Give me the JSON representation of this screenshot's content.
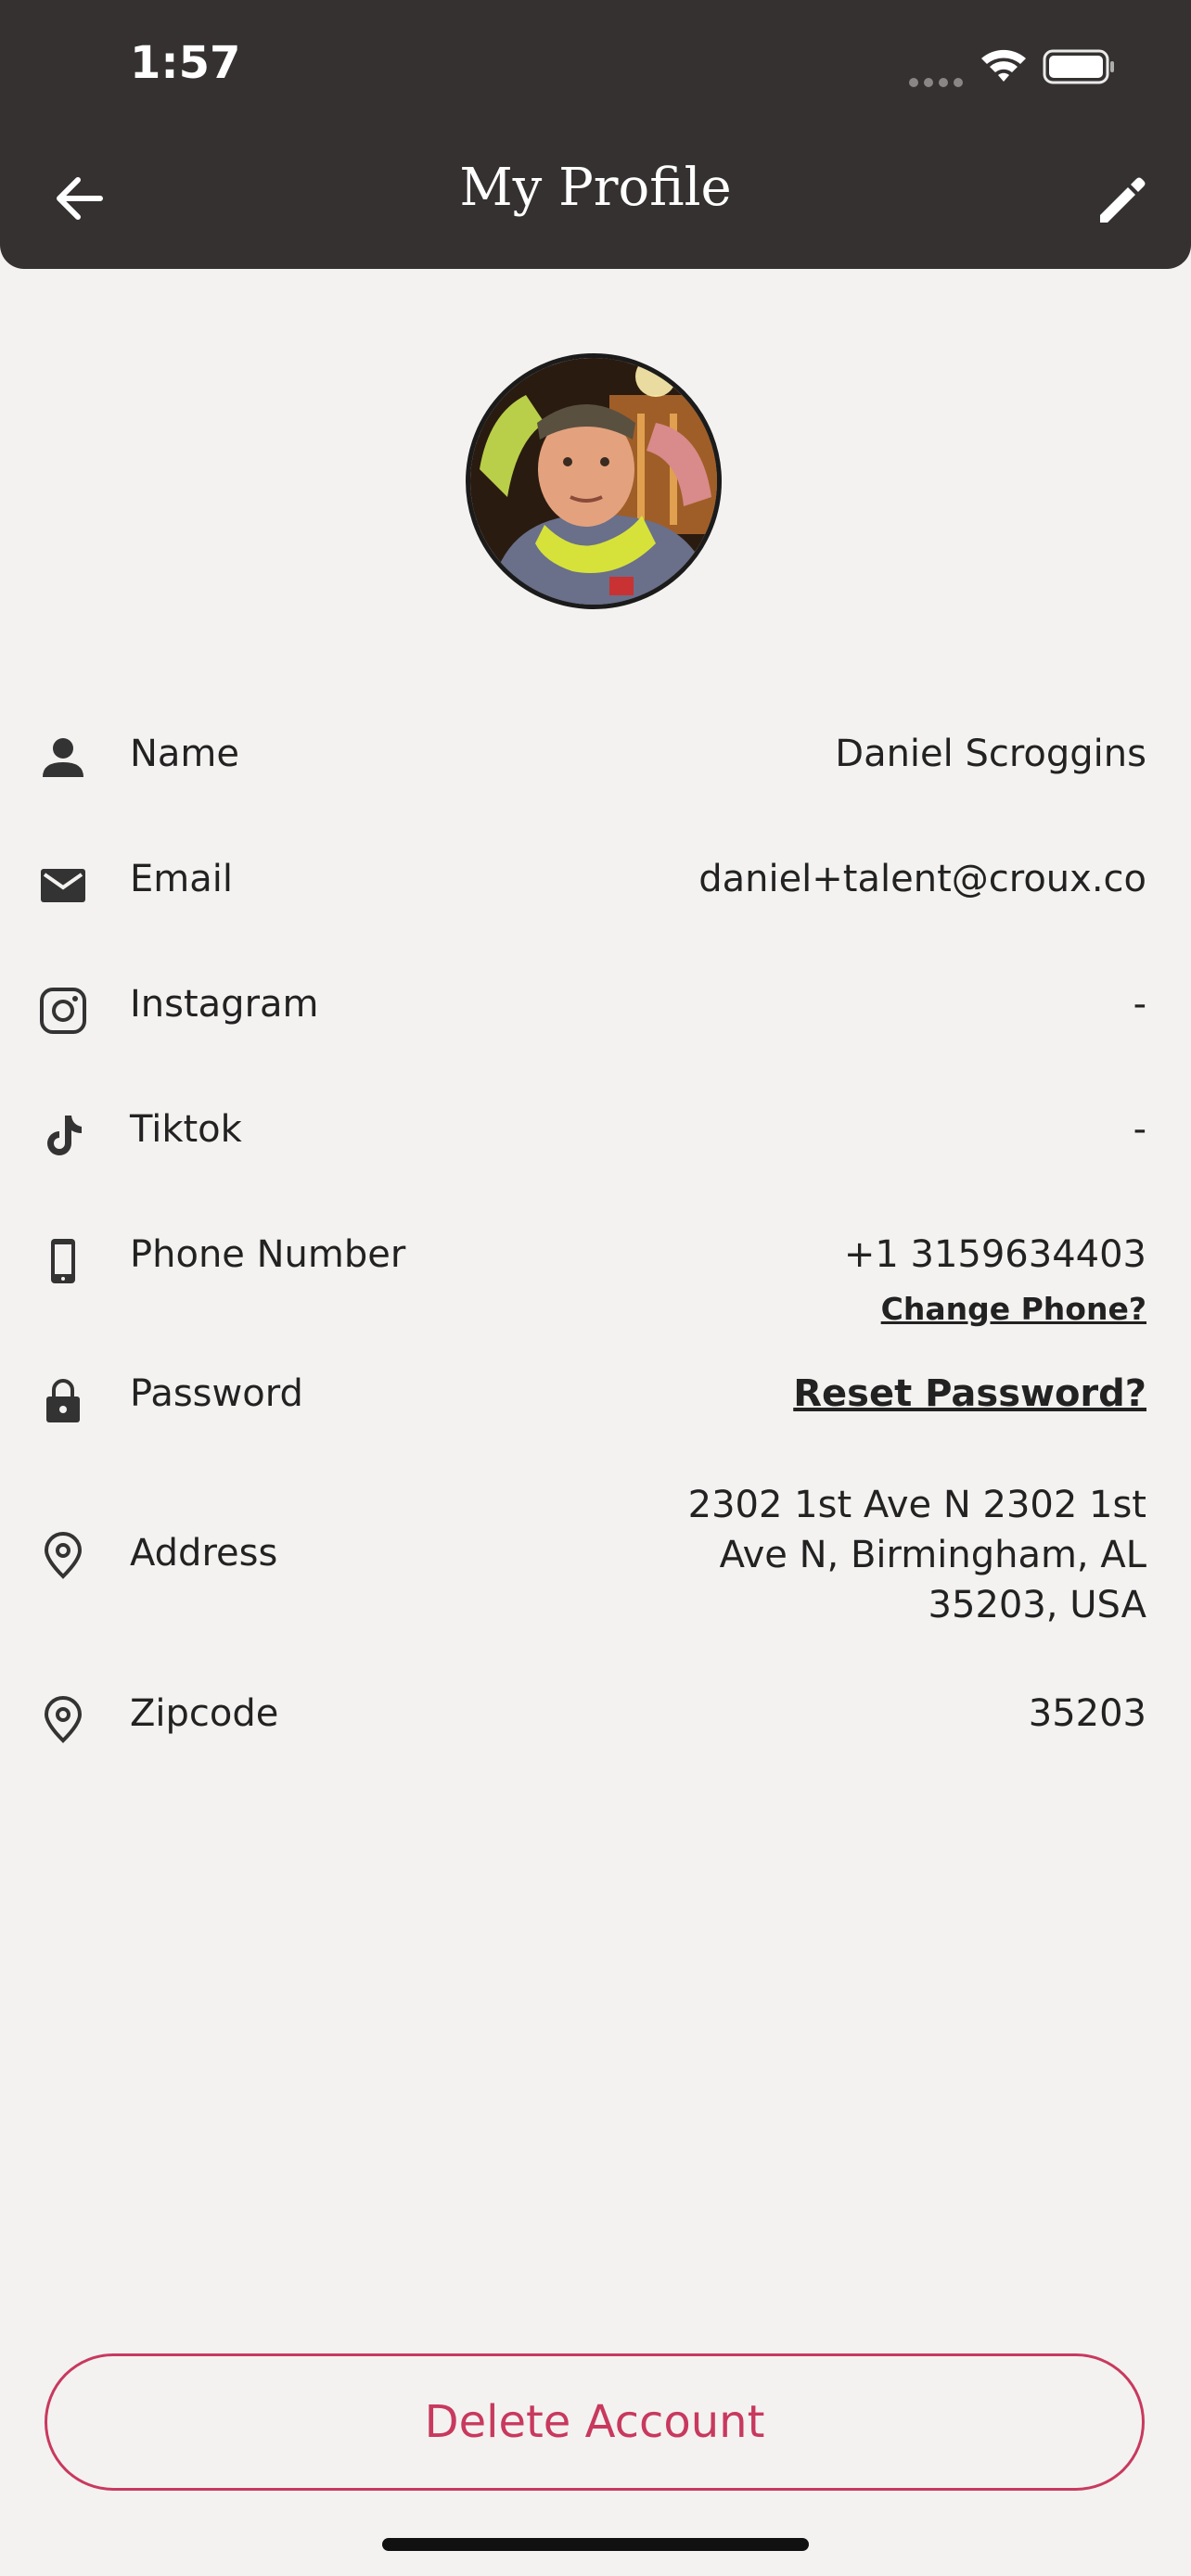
{
  "status_bar": {
    "time": "1:57"
  },
  "header": {
    "title": "My Profile"
  },
  "profile": {
    "name_label": "Name",
    "name_value": "Daniel Scroggins",
    "email_label": "Email",
    "email_value": "daniel+talent@croux.co",
    "instagram_label": "Instagram",
    "instagram_value": "-",
    "tiktok_label": "Tiktok",
    "tiktok_value": "-",
    "phone_label": "Phone Number",
    "phone_value": "+1 3159634403",
    "phone_link": "Change Phone?",
    "password_label": "Password",
    "password_link": "Reset Password?",
    "address_label": "Address",
    "address_line1": "2302 1st Ave N 2302 1st",
    "address_line2": "Ave N, Birmingham, AL",
    "address_line3": "35203, USA",
    "zipcode_label": "Zipcode",
    "zipcode_value": "35203"
  },
  "footer": {
    "delete_label": "Delete Account"
  },
  "colors": {
    "header_bg": "#353130",
    "page_bg": "#f4f2f0",
    "danger": "#c8395e",
    "icon": "#333333"
  },
  "icons": [
    "back-arrow-icon",
    "pencil-icon",
    "person-icon",
    "mail-icon",
    "instagram-icon",
    "tiktok-icon",
    "phone-icon",
    "lock-icon",
    "location-pin-icon"
  ]
}
